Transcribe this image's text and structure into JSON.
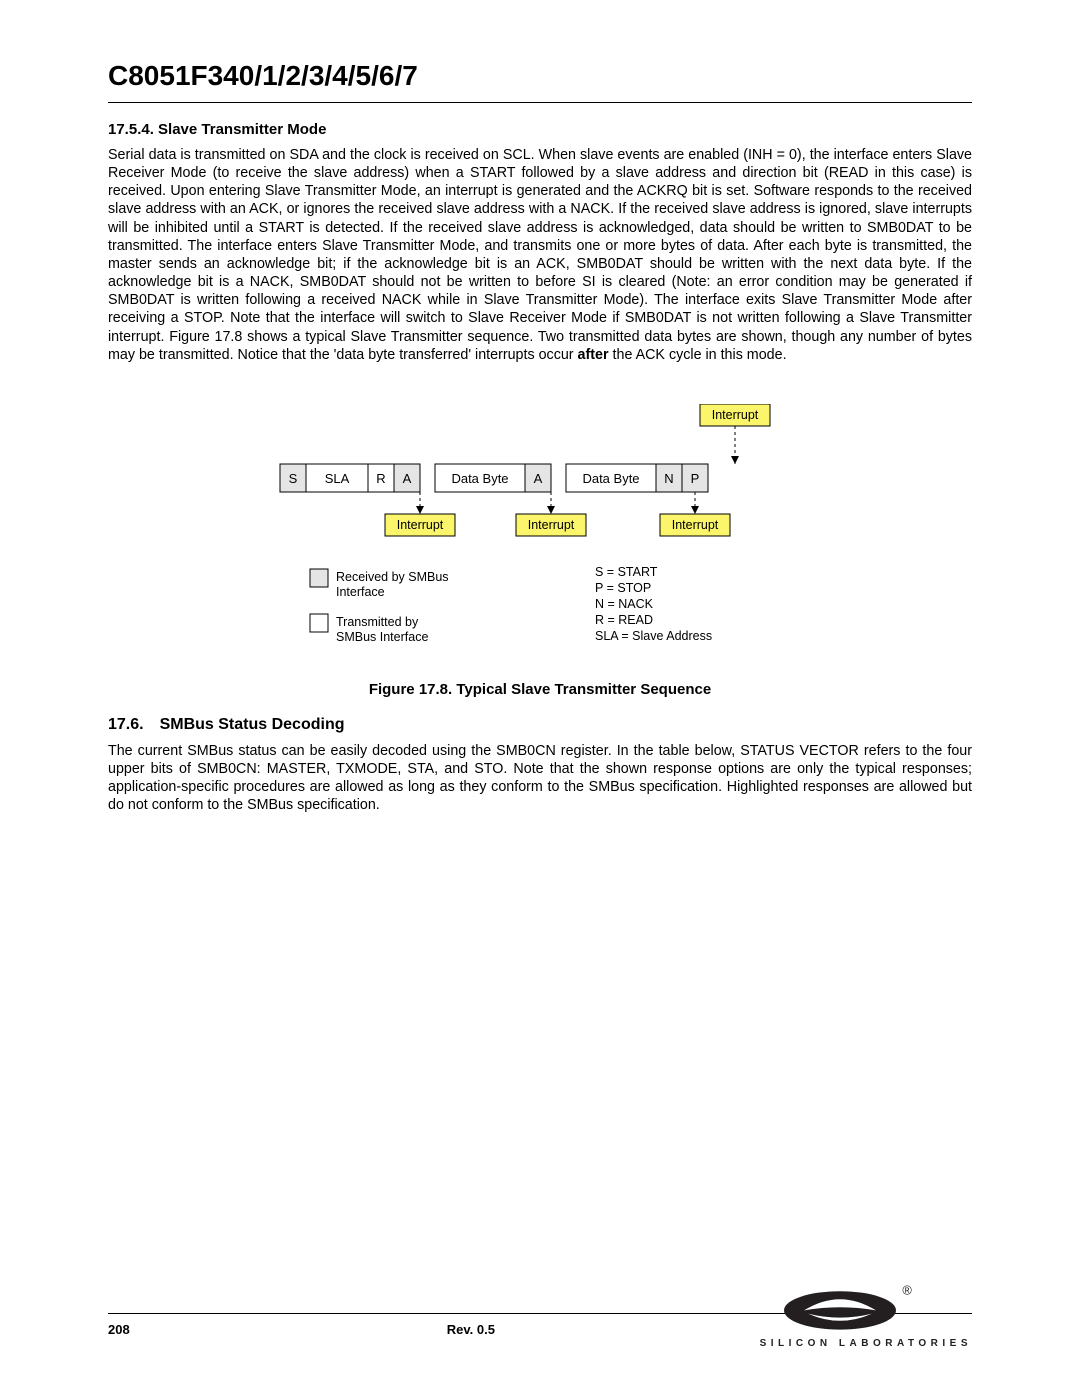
{
  "header": {
    "chip": "C8051F340/1/2/3/4/5/6/7"
  },
  "section_1": {
    "heading": "17.5.4. Slave Transmitter Mode",
    "para_pre": "Serial data is transmitted on SDA and the clock is received on SCL. When slave events are enabled (INH = 0), the interface enters Slave Receiver Mode (to receive the slave address) when a START followed by a slave address and direction bit (READ in this case) is received. Upon entering Slave Transmitter Mode, an interrupt is generated and the ACKRQ bit is set. Software responds to the received slave address with an ACK, or ignores the received slave address with a NACK. If the received slave address is ignored, slave interrupts will be inhibited until a START is detected. If the received slave address is acknowledged, data should be written to SMB0DAT to be transmitted. The interface enters Slave Transmitter Mode, and transmits one or more bytes of data. After each byte is transmitted, the master sends an acknowledge bit; if the acknowledge bit is an ACK, SMB0DAT should be written with the next data byte. If the acknowledge bit is a NACK, SMB0DAT should not be written to before SI is cleared (Note: an error condition may be generated if SMB0DAT is written following a received NACK while in Slave Transmitter Mode). The interface exits Slave Transmitter Mode after receiving a STOP. Note that the interface will switch to Slave Receiver Mode if SMB0DAT is not written following a Slave Transmitter interrupt. Figure 17.8 shows a typical Slave Transmitter sequence. Two transmitted data bytes are shown, though any number of bytes may be transmitted. Notice that the 'data byte transferred' interrupts occur ",
    "para_bold": "after",
    "para_post": " the ACK cycle in this mode."
  },
  "figure": {
    "caption": "Figure 17.8. Typical Slave Transmitter Sequence",
    "seq": {
      "s": "S",
      "sla": "SLA",
      "r": "R",
      "a": "A",
      "db": "Data Byte",
      "n": "N",
      "p": "P"
    },
    "interrupt": "Interrupt",
    "legend": {
      "received": "Received by SMBus Interface",
      "transmitted": "Transmitted by SMBus Interface"
    },
    "key": {
      "s": "S = START",
      "p": "P = STOP",
      "n": "N = NACK",
      "r": "R = READ",
      "sla": "SLA = Slave Address"
    }
  },
  "section_2": {
    "heading": "17.6. SMBus Status Decoding",
    "para": "The current SMBus status can be easily decoded using the SMB0CN register. In the table below, STATUS VECTOR refers to the four upper bits of SMB0CN: MASTER, TXMODE, STA, and STO. Note that the shown response options are only the typical responses; application-specific procedures are allowed as long as they conform to the SMBus specification. Highlighted responses are allowed but do not conform to the SMBus specification."
  },
  "footer": {
    "page": "208",
    "rev": "Rev. 0.5",
    "brand": "SILICON LABORATORIES"
  }
}
